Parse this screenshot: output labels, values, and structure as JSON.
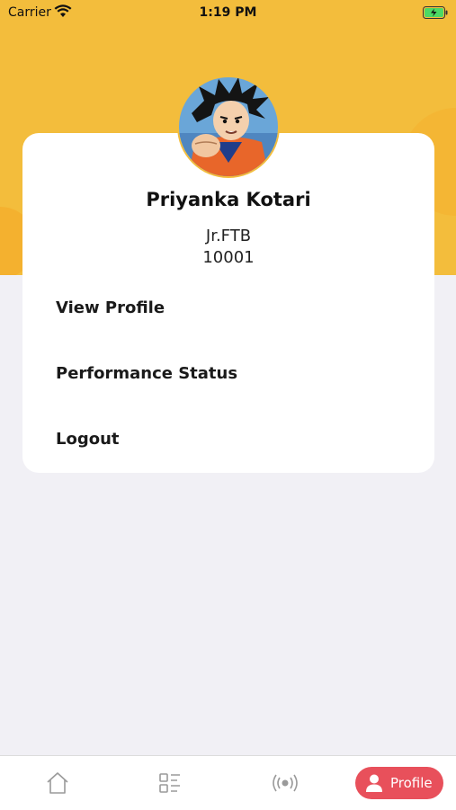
{
  "status_bar": {
    "carrier": "Carrier",
    "time": "1:19 PM"
  },
  "profile": {
    "name": "Priyanka Kotari",
    "role": "Jr.FTB",
    "employee_id": "10001",
    "avatar_icon": "anime-character-avatar"
  },
  "menu": {
    "items": [
      {
        "label": "View Profile"
      },
      {
        "label": "Performance Status"
      },
      {
        "label": "Logout"
      }
    ]
  },
  "tab_bar": {
    "tabs": [
      {
        "icon": "home-icon"
      },
      {
        "icon": "list-icon"
      },
      {
        "icon": "broadcast-icon"
      },
      {
        "icon": "profile-icon",
        "label": "Profile",
        "active": true
      }
    ]
  },
  "colors": {
    "header": "#f3bd3c",
    "accent": "#e8505b",
    "background": "#f1f0f5"
  }
}
